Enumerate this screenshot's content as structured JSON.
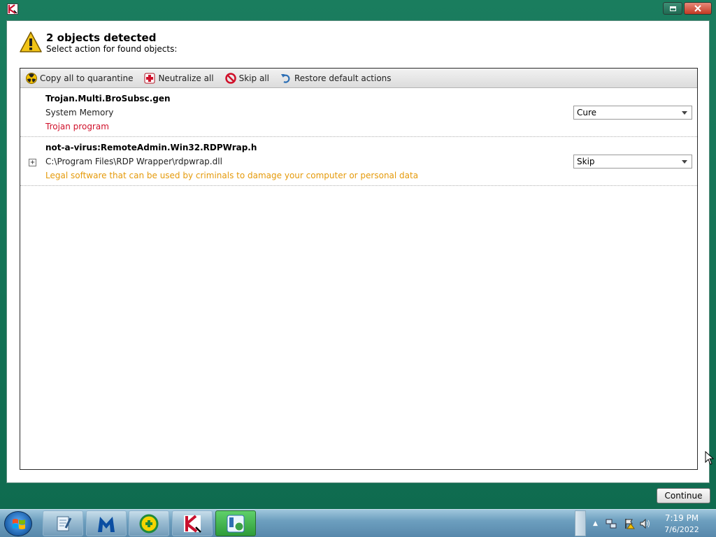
{
  "window": {
    "title": ""
  },
  "header": {
    "title": "2 objects detected",
    "subtitle": "Select action for found objects:"
  },
  "toolbar": {
    "items": [
      {
        "label": "Copy all to quarantine",
        "icon": "radiation-icon"
      },
      {
        "label": "Neutralize all",
        "icon": "red-cross-icon"
      },
      {
        "label": "Skip all",
        "icon": "no-entry-icon"
      },
      {
        "label": "Restore default actions",
        "icon": "undo-arrow-icon"
      }
    ]
  },
  "objects": [
    {
      "name": "Trojan.Multi.BroSubsc.gen",
      "location": "System Memory",
      "description": "Trojan program",
      "description_color": "#d0102a",
      "action": "Cure",
      "expandable": false
    },
    {
      "name": "not-a-virus:RemoteAdmin.Win32.RDPWrap.h",
      "location": "C:\\Program Files\\RDP Wrapper\\rdpwrap.dll",
      "description": "Legal software that can be used by criminals to damage your computer or personal data",
      "description_color": "#e59a0a",
      "action": "Skip",
      "expandable": true
    }
  ],
  "footer": {
    "continue_label": "Continue"
  },
  "taskbar": {
    "apps": [
      "notepad-app",
      "malwarebytes-app",
      "update-app",
      "kaspersky-app",
      "iobit-app"
    ],
    "clock_time": "7:19 PM",
    "clock_date": "7/6/2022"
  }
}
